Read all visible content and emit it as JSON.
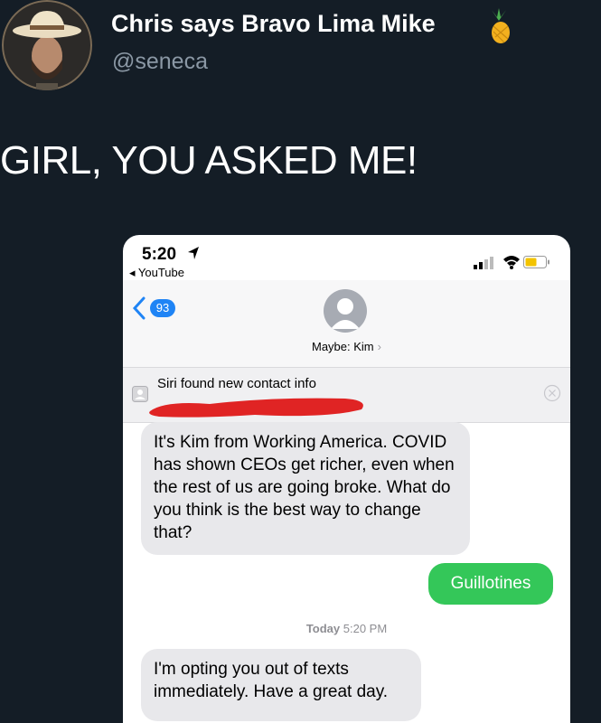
{
  "tweet": {
    "display_name": "Chris says Bravo Lima Mike",
    "handle": "@seneca",
    "text": "GIRL, YOU ASKED ME!"
  },
  "phone": {
    "status": {
      "time": "5:20",
      "back_app": "◂ YouTube"
    },
    "nav": {
      "unread_count": "93",
      "contact_label": "Maybe: Kim",
      "chevron": "›"
    },
    "siri_banner": {
      "title": "Siri found new contact info"
    },
    "messages": [
      {
        "direction": "incoming",
        "text": "It's Kim from Working America. COVID has shown CEOs get richer, even when the rest of us are going broke. What do you think is the best way to change that?"
      },
      {
        "direction": "outgoing",
        "text": "Guillotines"
      },
      {
        "direction": "incoming",
        "text": "I'm opting you out of texts immediately. Have a great day."
      }
    ],
    "timestamp": {
      "day": "Today",
      "time": "5:20 PM"
    }
  },
  "colors": {
    "background": "#141d26",
    "handle": "#8b98a5",
    "outgoing_bubble": "#34c759",
    "incoming_bubble": "#e8e8eb",
    "badge": "#1f84f5",
    "redaction": "#e02424"
  },
  "icons": [
    "pineapple-icon",
    "location-arrow-icon",
    "signal-icon",
    "wifi-icon",
    "battery-icon",
    "back-chevron-icon",
    "contact-avatar-icon",
    "siri-contact-icon",
    "dismiss-icon"
  ]
}
